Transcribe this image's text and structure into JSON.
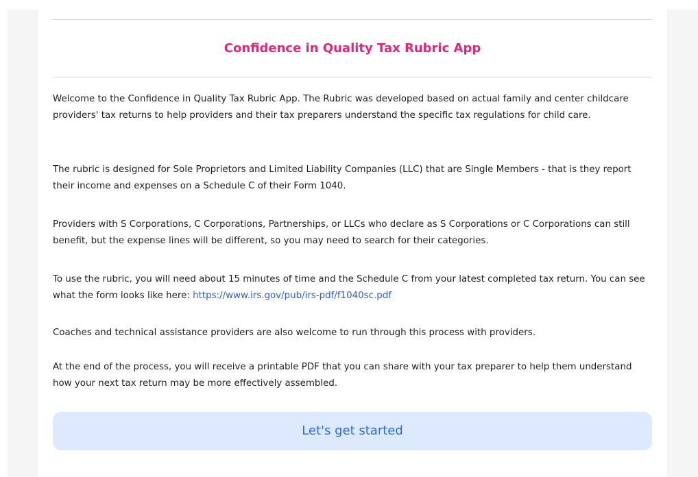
{
  "app": {
    "title": "Confidence in Quality Tax Rubric App"
  },
  "intro": {
    "p1": "Welcome to the Confidence in Quality Tax Rubric App. The Rubric was developed based on actual family and center childcare providers' tax returns to help providers and their tax preparers understand the specific tax regulations for child care.",
    "p2": "The rubric is designed for Sole Proprietors and Limited Liability Companies (LLC) that are Single Members - that is they report their income and expenses on a Schedule C of their Form 1040.",
    "p3": "Providers with S Corporations, C Corporations, Partnerships, or LLCs who declare as S Corporations or C Corporations can still benefit, but the expense lines will be different, so you may need to search for their categories.",
    "p4_text": "To use the rubric, you will need about 15 minutes of time and the Schedule C from your latest completed tax return. You can see what the form looks like here: ",
    "p4_link": "https://www.irs.gov/pub/irs-pdf/f1040sc.pdf",
    "p5": "Coaches and technical assistance providers are also welcome to run through this process with providers.",
    "p6": "At the end of the process, you will receive a printable PDF that you can share with your tax preparer to help them understand how your next tax return may be more effectively assembled."
  },
  "actions": {
    "start_label": "Let's get started"
  },
  "colors": {
    "title": "#e0277a",
    "link": "#2f5fd6",
    "button_bg": "#dde9fd",
    "button_text": "#2b6dd4"
  }
}
